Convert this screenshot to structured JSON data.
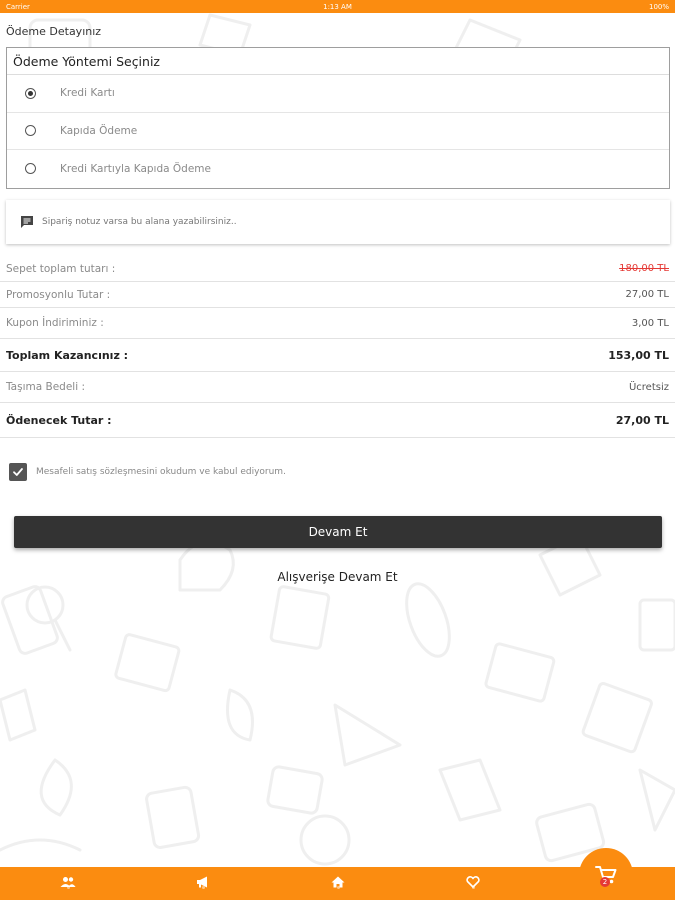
{
  "status_bar": {
    "carrier": "Carrier",
    "time": "1:13 AM",
    "battery": "100%"
  },
  "payment": {
    "section_title": "Ödeme Detayınız",
    "methods_title": "Ödeme Yöntemi Seçiniz",
    "methods": [
      {
        "label": "Kredi Kartı",
        "selected": true
      },
      {
        "label": "Kapıda Ödeme",
        "selected": false
      },
      {
        "label": "Kredi Kartıyla Kapıda Ödeme",
        "selected": false
      }
    ]
  },
  "note": {
    "placeholder": "Sipariş notuz varsa bu alana yazabilirsiniz.."
  },
  "summary": {
    "rows": [
      {
        "label": "Sepet toplam tutarı :",
        "value": "180,00 TL"
      },
      {
        "label": "Promosyonlu Tutar :",
        "value": "27,00 TL"
      },
      {
        "label": "Kupon İndiriminiz :",
        "value": "3,00 TL"
      },
      {
        "label": "Toplam Kazancınız :",
        "value": "153,00 TL"
      },
      {
        "label": "Taşıma Bedeli :",
        "value": "Ücretsiz"
      },
      {
        "label": "Ödenecek Tutar :",
        "value": "27,00 TL"
      }
    ]
  },
  "agreement": {
    "text": "Mesafeli satış sözleşmesini okudum ve kabul ediyorum.",
    "checked": true
  },
  "buttons": {
    "continue": "Devam Et",
    "continue_shopping": "Alışverişe Devam Et"
  },
  "tabbar": {
    "icons": [
      "people-icon",
      "megaphone-icon",
      "home-icon",
      "heart-icon",
      "cart-icon"
    ],
    "cart_badge": "2"
  },
  "colors": {
    "accent": "#fb8c10",
    "dark_button": "#333333",
    "strike_price": "#e53935"
  }
}
